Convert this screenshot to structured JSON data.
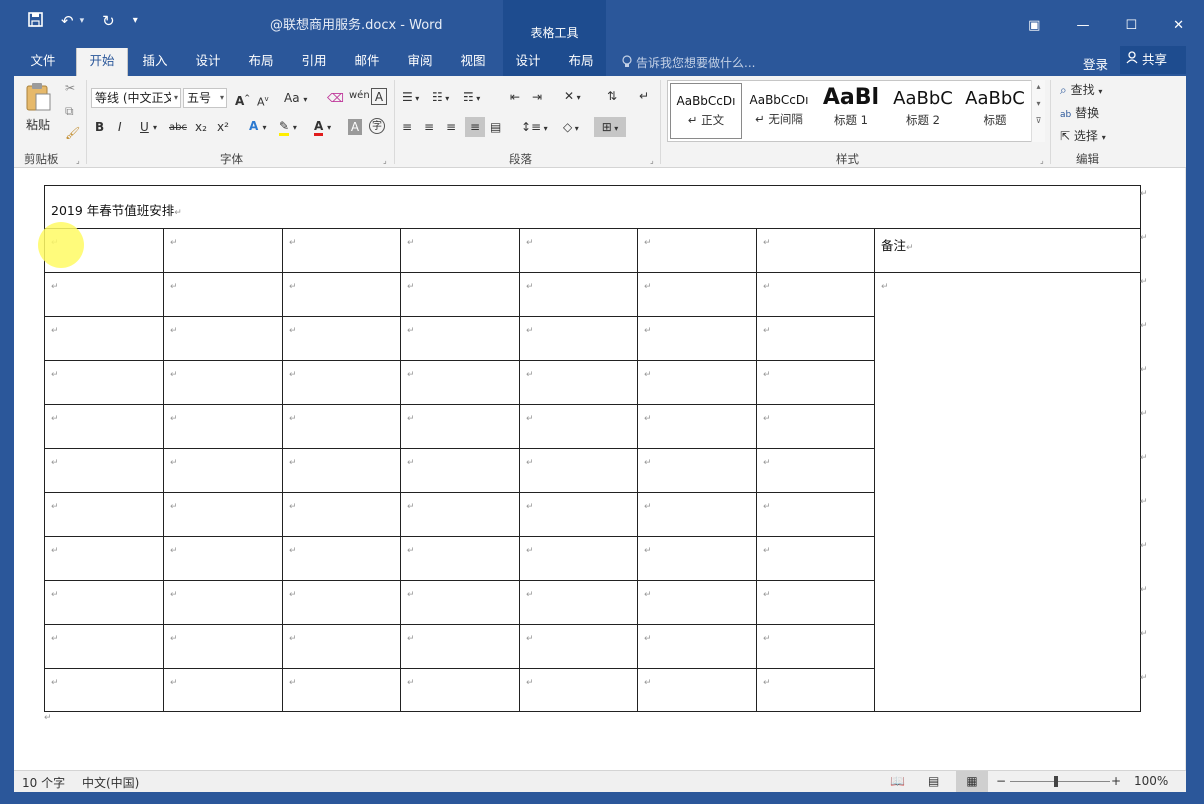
{
  "window": {
    "title": "@联想商用服务.docx - Word",
    "context_tab_group": "表格工具",
    "qat": {
      "save": "save-icon",
      "undo": "undo-icon",
      "redo": "redo-icon",
      "customize": "customize-icon"
    },
    "controls": {
      "ribbon_display": "▣",
      "minimize": "—",
      "maximize": "☐",
      "close": "✕"
    }
  },
  "tabs": {
    "file": "文件",
    "home": "开始",
    "insert": "插入",
    "design": "设计",
    "layout": "布局",
    "references": "引用",
    "mailings": "邮件",
    "review": "审阅",
    "view": "视图",
    "table_design": "设计",
    "table_layout": "布局",
    "tell_me": "告诉我您想要做什么...",
    "sign_in": "登录",
    "share": "共享"
  },
  "ribbon": {
    "clipboard": {
      "paste": "粘贴",
      "label": "剪贴板"
    },
    "font": {
      "font_name": "等线 (中文正文",
      "font_size": "五号",
      "grow": "A",
      "shrink": "A",
      "change_case": "Aa",
      "bold": "B",
      "italic": "I",
      "underline": "U",
      "strike": "abc",
      "subscript": "x₂",
      "superscript": "x²",
      "label": "字体"
    },
    "paragraph": {
      "label": "段落"
    },
    "styles": {
      "items": [
        {
          "sample": "AaBbCcDı",
          "name": "↵ 正文"
        },
        {
          "sample": "AaBbCcDı",
          "name": "↵ 无间隔"
        },
        {
          "sample": "AaBl",
          "name": "标题 1"
        },
        {
          "sample": "AaBbC",
          "name": "标题 2"
        },
        {
          "sample": "AaBbC",
          "name": "标题"
        }
      ],
      "label": "样式"
    },
    "editing": {
      "find": "查找",
      "replace": "替换",
      "select": "选择",
      "label": "编辑"
    }
  },
  "document": {
    "table_title": "2019 年春节值班安排",
    "remarks_header": "备注",
    "paragraph_mark": "↵"
  },
  "status": {
    "word_count": "10 个字",
    "language": "中文(中国)",
    "zoom": "100%",
    "zoom_minus": "−",
    "zoom_plus": "+"
  }
}
